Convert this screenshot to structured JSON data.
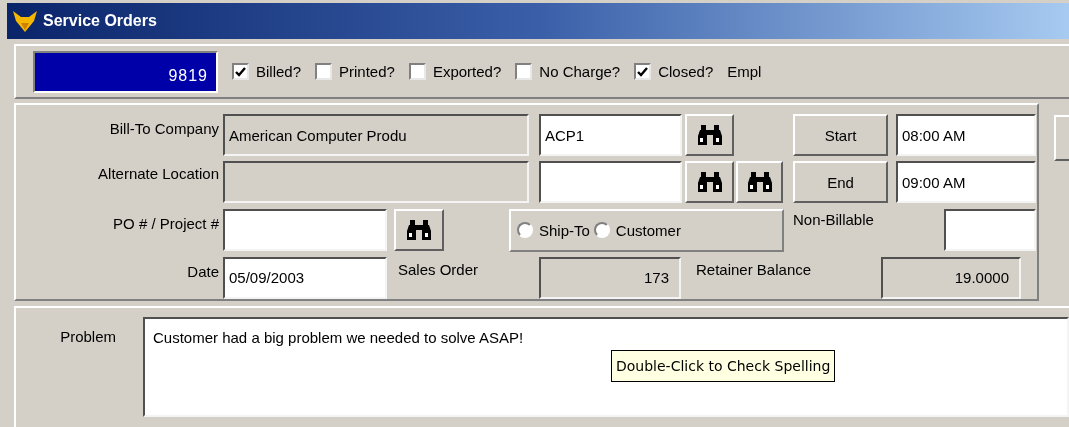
{
  "window": {
    "title": "Service Orders"
  },
  "header": {
    "order_number": "9819",
    "checkboxes": [
      {
        "label": "Billed?",
        "checked": true
      },
      {
        "label": "Printed?",
        "checked": false
      },
      {
        "label": "Exported?",
        "checked": false
      },
      {
        "label": "No Charge?",
        "checked": false
      },
      {
        "label": "Closed?",
        "checked": true
      }
    ],
    "trailing_label": "Empl"
  },
  "form": {
    "bill_to": {
      "label": "Bill-To Company",
      "company": "American Computer Produ",
      "code": "ACP1"
    },
    "alternate_location": {
      "label": "Alternate Location"
    },
    "po": {
      "label": "PO # / Project #"
    },
    "date": {
      "label": "Date",
      "value": "05/09/2003"
    },
    "sales_order": {
      "label": "Sales Order",
      "value": "173"
    },
    "retainer_balance": {
      "label": "Retainer Balance",
      "value": "19.0000"
    },
    "non_billable": {
      "label": "Non-Billable"
    },
    "start": {
      "button": "Start",
      "time": "08:00 AM"
    },
    "end": {
      "button": "End",
      "time": "09:00 AM"
    },
    "address_source": [
      {
        "label": "Ship-To",
        "selected": false
      },
      {
        "label": "Customer",
        "selected": false
      }
    ]
  },
  "problem": {
    "label": "Problem",
    "text": "Customer had a big problem we needed to solve ASAP!",
    "tooltip": "Double-Click to Check Spelling"
  }
}
